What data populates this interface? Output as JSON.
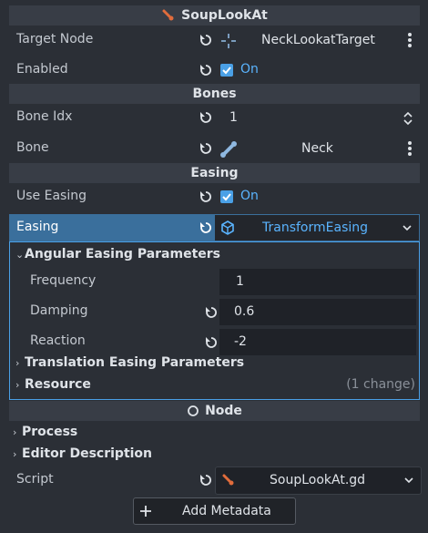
{
  "title": {
    "name": "SoupLookAt"
  },
  "target_node": {
    "label": "Target Node",
    "value": "NeckLookatTarget"
  },
  "enabled": {
    "label": "Enabled",
    "value": "On"
  },
  "bones_header": "Bones",
  "bone_idx": {
    "label": "Bone Idx",
    "value": "1"
  },
  "bone": {
    "label": "Bone",
    "value": "Neck"
  },
  "easing_header": "Easing",
  "use_easing": {
    "label": "Use Easing",
    "value": "On"
  },
  "easing": {
    "label": "Easing",
    "value": "TransformEasing"
  },
  "angular": {
    "title": "Angular Easing Parameters",
    "frequency": {
      "label": "Frequency",
      "value": "1"
    },
    "damping": {
      "label": "Damping",
      "value": "0.6"
    },
    "reaction": {
      "label": "Reaction",
      "value": "-2"
    }
  },
  "translation_title": "Translation Easing Parameters",
  "resource": {
    "label": "Resource",
    "changes": "(1 change)"
  },
  "node_header": "Node",
  "process": "Process",
  "editor_description": "Editor Description",
  "script": {
    "label": "Script",
    "value": "SoupLookAt.gd"
  },
  "add_metadata": "Add Metadata",
  "colors": {
    "accent": "#4aa0e6",
    "on_text": "#5ab4ff",
    "easing_row": "#3a6f9c",
    "script_icon": "#e06c3c"
  }
}
